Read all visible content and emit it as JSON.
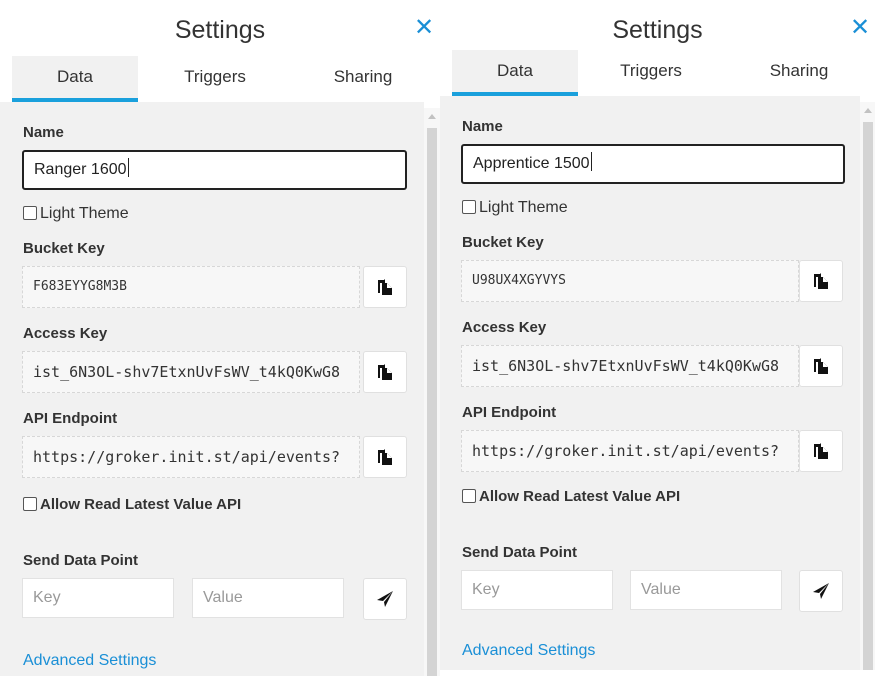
{
  "panels": [
    {
      "title": "Settings",
      "tabs": [
        "Data",
        "Triggers",
        "Sharing"
      ],
      "name_label": "Name",
      "name_value": "Ranger 1600",
      "light_theme_label": "Light Theme",
      "bucket_key_label": "Bucket Key",
      "bucket_key_value": "F683EYYG8M3B",
      "access_key_label": "Access Key",
      "access_key_value": "ist_6N3OL-shv7EtxnUvFsWV_t4kQ0KwG8",
      "api_endpoint_label": "API Endpoint",
      "api_endpoint_value": "https://groker.init.st/api/events?",
      "allow_read_label": "Allow Read Latest Value API",
      "send_data_point_label": "Send Data Point",
      "key_placeholder": "Key",
      "value_placeholder": "Value",
      "advanced_settings_label": "Advanced Settings"
    },
    {
      "title": "Settings",
      "tabs": [
        "Data",
        "Triggers",
        "Sharing"
      ],
      "name_label": "Name",
      "name_value": "Apprentice 1500",
      "light_theme_label": "Light Theme",
      "bucket_key_label": "Bucket Key",
      "bucket_key_value": "U98UX4XGYVYS",
      "access_key_label": "Access Key",
      "access_key_value": "ist_6N3OL-shv7EtxnUvFsWV_t4kQ0KwG8",
      "api_endpoint_label": "API Endpoint",
      "api_endpoint_value": "https://groker.init.st/api/events?",
      "allow_read_label": "Allow Read Latest Value API",
      "send_data_point_label": "Send Data Point",
      "key_placeholder": "Key",
      "value_placeholder": "Value",
      "advanced_settings_label": "Advanced Settings"
    }
  ],
  "icons": {
    "close": "close-icon",
    "copy": "copy-icon",
    "send": "paper-plane-icon"
  },
  "colors": {
    "accent": "#1aa0dc",
    "link": "#1a8fd6",
    "panel_background": "#f1f1f1"
  }
}
